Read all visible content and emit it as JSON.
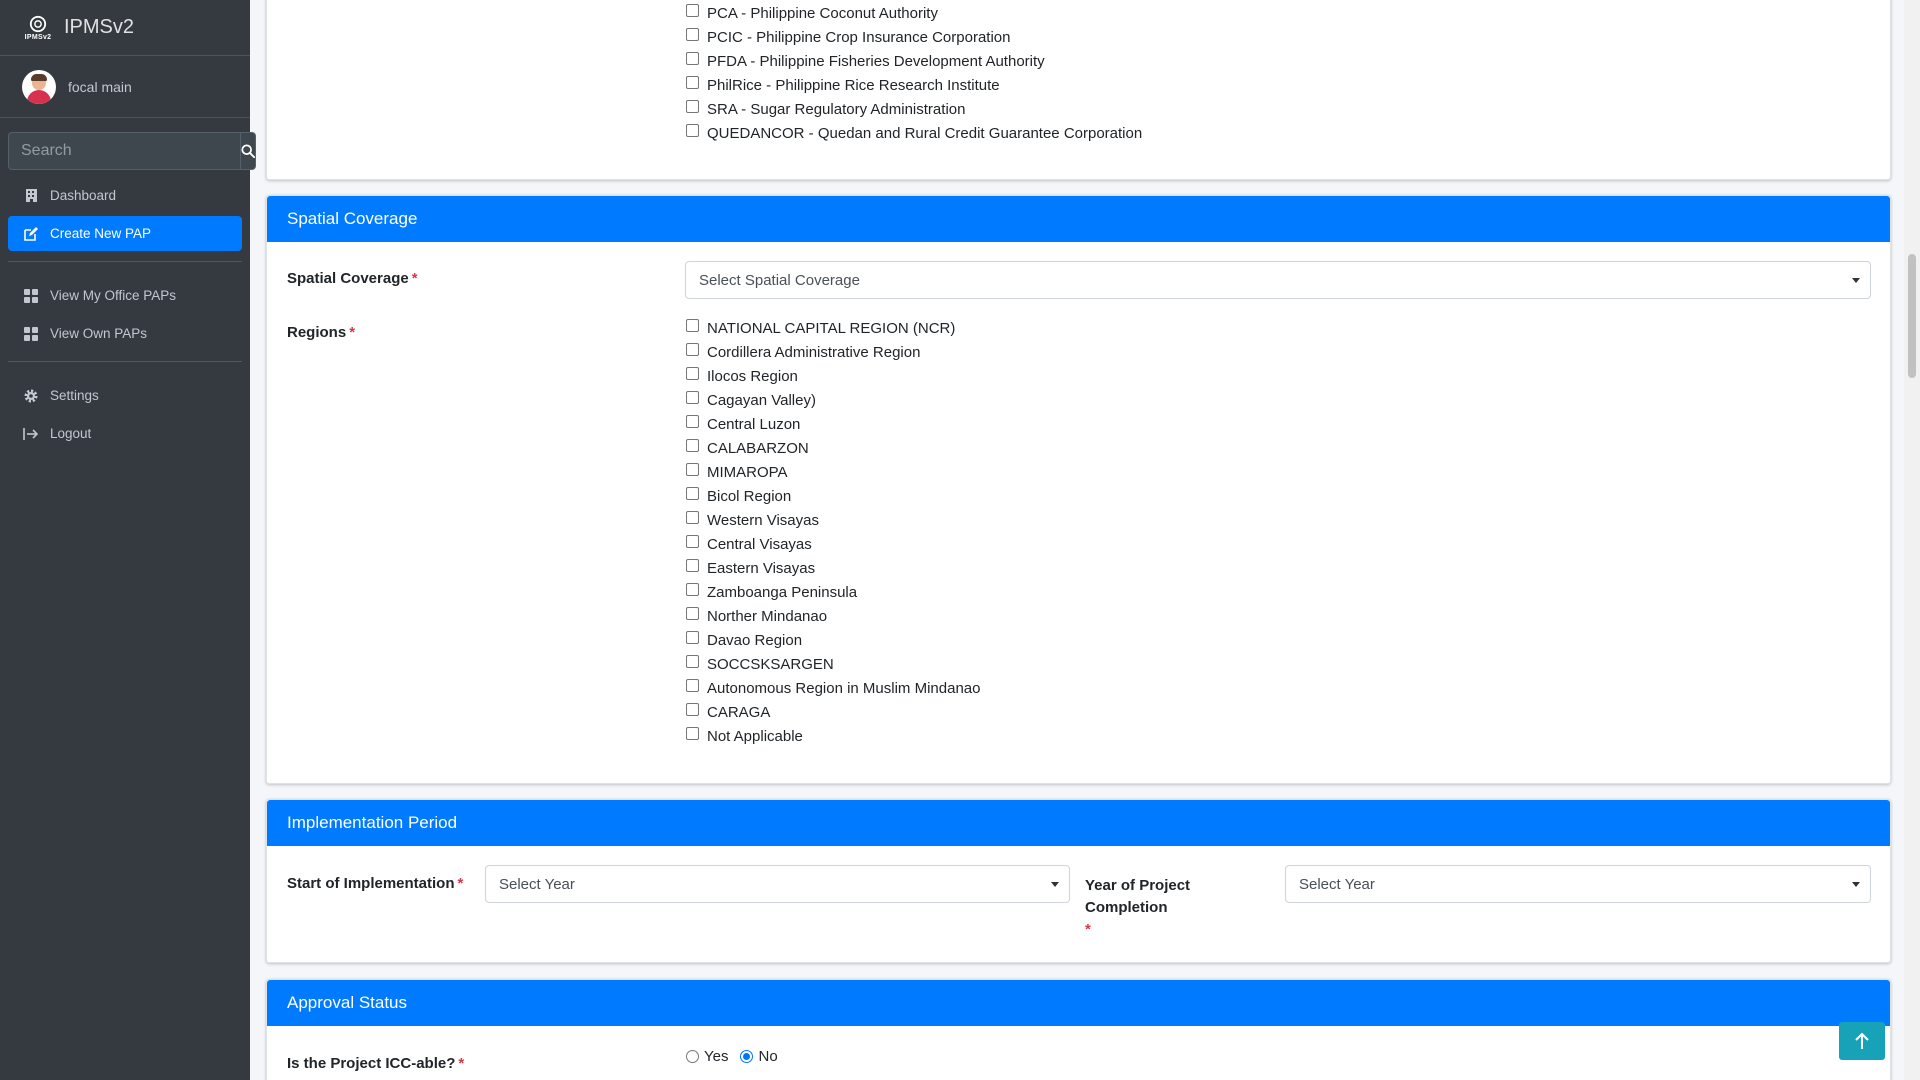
{
  "brand": {
    "logo_text": "IPMSv2",
    "name": "IPMSv2"
  },
  "user": {
    "name": "focal main"
  },
  "search": {
    "placeholder": "Search"
  },
  "nav": {
    "dashboard": "Dashboard",
    "create_new_pap": "Create New PAP",
    "view_my_office_paps": "View My Office PAPs",
    "view_own_paps": "View Own PAPs",
    "settings": "Settings",
    "logout": "Logout"
  },
  "agencies": {
    "items": [
      "PCA - Philippine Coconut Authority",
      "PCIC - Philippine Crop Insurance Corporation",
      "PFDA - Philippine Fisheries Development Authority",
      "PhilRice - Philippine Rice Research Institute",
      "SRA - Sugar Regulatory Administration",
      "QUEDANCOR - Quedan and Rural Credit Guarantee Corporation"
    ]
  },
  "spatial": {
    "header": "Spatial Coverage",
    "coverage_label": "Spatial Coverage",
    "coverage_placeholder": "Select Spatial Coverage",
    "regions_label": "Regions",
    "regions": [
      "NATIONAL CAPITAL REGION (NCR)",
      "Cordillera Administrative Region",
      "Ilocos Region",
      "Cagayan Valley)",
      "Central Luzon",
      "CALABARZON",
      "MIMAROPA",
      "Bicol Region",
      "Western Visayas",
      "Central Visayas",
      "Eastern Visayas",
      "Zamboanga Peninsula",
      "Norther Mindanao",
      "Davao Region",
      "SOCCSKSARGEN",
      "Autonomous Region in Muslim Mindanao",
      "CARAGA",
      "Not Applicable"
    ]
  },
  "implementation": {
    "header": "Implementation Period",
    "start_label": "Start of Implementation",
    "start_placeholder": "Select Year",
    "completion_label": "Year of Project Completion",
    "completion_placeholder": "Select Year"
  },
  "approval": {
    "header": "Approval Status",
    "icc_label": "Is the Project ICC-able?",
    "yes": "Yes",
    "no": "No",
    "selected": "No"
  },
  "colors": {
    "primary": "#007bff",
    "sidebar": "#343a40",
    "required": "#dc3545",
    "back_to_top": "#17a2b8"
  }
}
